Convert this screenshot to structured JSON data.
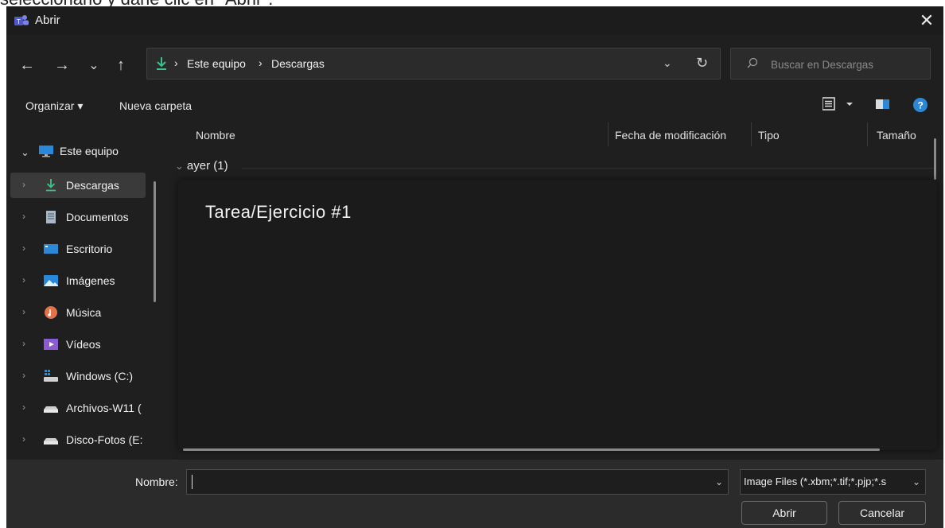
{
  "caption": "seleccionarlo y darle clic en \"Abrir\".",
  "window": {
    "title": "Abrir",
    "close_glyph": "✕"
  },
  "nav": {
    "back": "←",
    "forward": "→",
    "recent": "⌄",
    "up": "↑"
  },
  "address": {
    "crumbs": [
      "Este equipo",
      "Descargas"
    ],
    "separator": "›",
    "dropdown": "⌄",
    "refresh": "↻"
  },
  "search": {
    "placeholder": "Buscar en Descargas"
  },
  "toolbar": {
    "organize": "Organizar ▾",
    "new_folder": "Nueva carpeta"
  },
  "sidebar": {
    "root": {
      "label": "Este equipo",
      "icon": "monitor-icon"
    },
    "items": [
      {
        "label": "Descargas",
        "icon": "download-icon",
        "selected": true
      },
      {
        "label": "Documentos",
        "icon": "document-icon"
      },
      {
        "label": "Escritorio",
        "icon": "desktop-icon"
      },
      {
        "label": "Imágenes",
        "icon": "pictures-icon"
      },
      {
        "label": "Música",
        "icon": "music-icon"
      },
      {
        "label": "Vídeos",
        "icon": "videos-icon"
      },
      {
        "label": "Windows (C:)",
        "icon": "windows-drive-icon"
      },
      {
        "label": "Archivos-W11 (",
        "icon": "drive-icon"
      },
      {
        "label": "Disco-Fotos (E:",
        "icon": "drive-icon"
      }
    ]
  },
  "columns": {
    "name": "Nombre",
    "date": "Fecha de modificación",
    "type": "Tipo",
    "size": "Tamaño"
  },
  "group": {
    "label": "ayer (1)"
  },
  "overlay": {
    "text": "Tarea/Ejercicio #1"
  },
  "bottom": {
    "name_label": "Nombre:",
    "name_value": "",
    "filter": "Image Files (*.xbm;*.tif;*.pjp;*.s",
    "open_button": "Abrir",
    "cancel_button": "Cancelar"
  },
  "colors": {
    "accent_blue": "#2b88d8",
    "download_green": "#3cc28b",
    "background": "#1f1f1f"
  }
}
